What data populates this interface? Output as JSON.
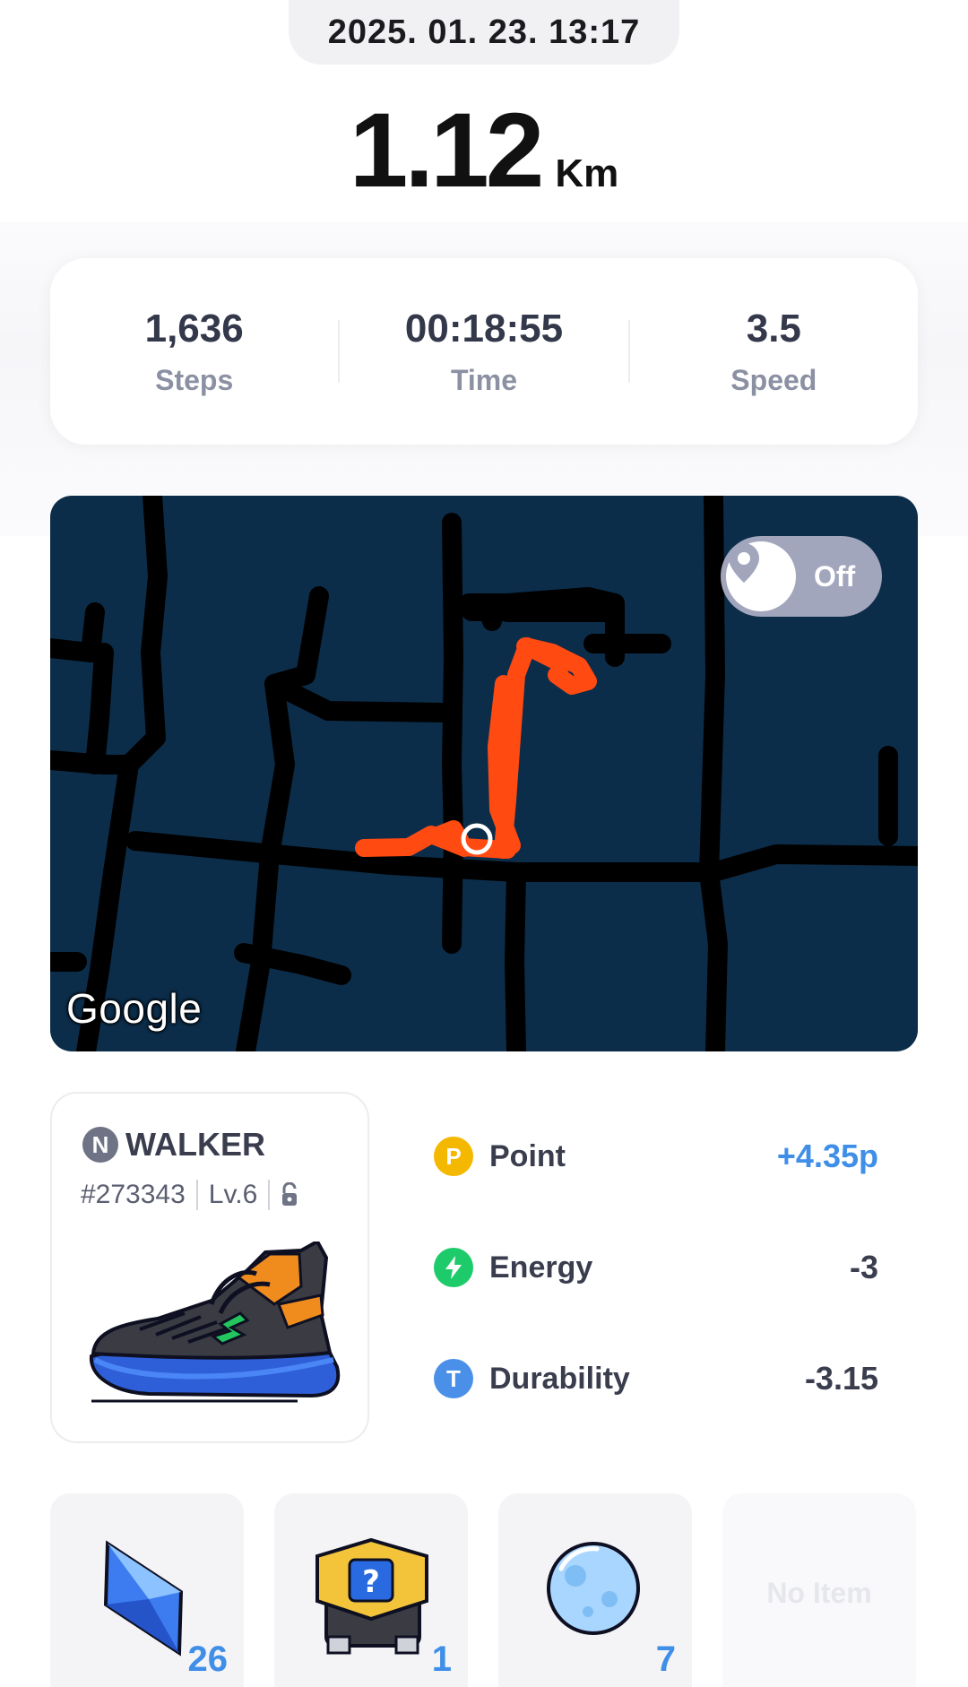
{
  "header": {
    "datetime": "2025. 01. 23. 13:17"
  },
  "distance": {
    "value": "1.12",
    "unit": "Km"
  },
  "stats": [
    {
      "value": "1,636",
      "label": "Steps"
    },
    {
      "value": "00:18:55",
      "label": "Time"
    },
    {
      "value": "3.5",
      "label": "Speed"
    }
  ],
  "map": {
    "location_toggle_label": "Off",
    "location_toggle_state": "off",
    "attribution": "Google"
  },
  "sneaker": {
    "badge": "N",
    "name": "WALKER",
    "id": "#273343",
    "level": "Lv.6"
  },
  "rewards": [
    {
      "icon": "point-icon",
      "icon_glyph": "P",
      "color": "#f5b800",
      "label": "Point",
      "value": "+4.35p"
    },
    {
      "icon": "energy-icon",
      "icon_glyph": "⚡",
      "color": "#1ecb6b",
      "label": "Energy",
      "value": "-3"
    },
    {
      "icon": "durability-icon",
      "icon_glyph": "T",
      "color": "#4a90e8",
      "label": "Durability",
      "value": "-3.15"
    }
  ],
  "items": [
    {
      "icon": "blue-gem-icon",
      "count": "26"
    },
    {
      "icon": "mystery-box-icon",
      "count": "1"
    },
    {
      "icon": "moon-orb-icon",
      "count": "7"
    },
    {
      "empty_label": "No Item"
    }
  ],
  "colors": {
    "accent_blue": "#3f8ee8",
    "map_background": "#0c2d4a",
    "route_orange": "#ff4a12"
  }
}
